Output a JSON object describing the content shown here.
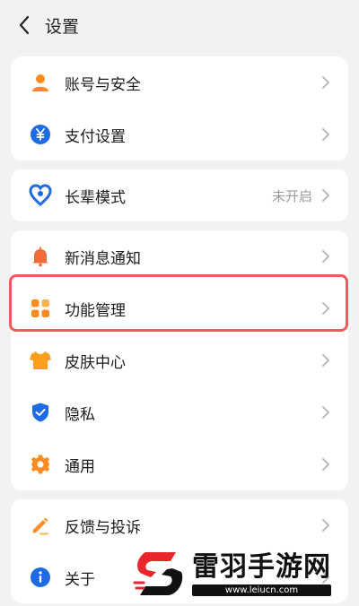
{
  "header": {
    "title": "设置"
  },
  "groups": [
    [
      {
        "label": "账号与安全",
        "icon": "person-icon"
      },
      {
        "label": "支付设置",
        "icon": "yuan-icon"
      }
    ],
    [
      {
        "label": "长辈模式",
        "icon": "heart-icon",
        "value": "未开启"
      }
    ],
    [
      {
        "label": "新消息通知",
        "icon": "bell-icon"
      },
      {
        "label": "功能管理",
        "icon": "grid-icon"
      },
      {
        "label": "皮肤中心",
        "icon": "shirt-icon"
      },
      {
        "label": "隐私",
        "icon": "shield-icon"
      },
      {
        "label": "通用",
        "icon": "gear-icon"
      }
    ],
    [
      {
        "label": "反馈与投诉",
        "icon": "pencil-icon"
      },
      {
        "label": "关于",
        "icon": "info-icon"
      }
    ]
  ],
  "watermark": {
    "name": "雷羽手游网",
    "url": "www.leiucn.com"
  },
  "colors": {
    "accent": "#ff8a1f",
    "blue": "#1e6be6",
    "highlight": "#f05a5a"
  }
}
